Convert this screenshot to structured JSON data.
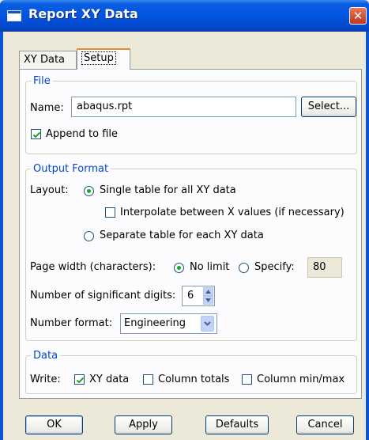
{
  "window": {
    "title": "Report XY Data",
    "close_glyph": "✕"
  },
  "tabs": [
    {
      "label": "XY Data",
      "selected": false
    },
    {
      "label": "Setup",
      "selected": true
    }
  ],
  "file": {
    "legend": "File",
    "name_label": "Name:",
    "name_value": "abaqus.rpt",
    "select_button": "Select...",
    "append_label": "Append to file",
    "append_checked": true
  },
  "output": {
    "legend": "Output Format",
    "layout_label": "Layout:",
    "single_label": "Single table for all XY data",
    "single_selected": true,
    "interpolate_label": "Interpolate between X values (if necessary)",
    "interpolate_checked": false,
    "separate_label": "Separate table for each XY data",
    "separate_selected": false,
    "page_width_label": "Page width (characters):",
    "no_limit_label": "No limit",
    "no_limit_selected": true,
    "specify_label": "Specify:",
    "specify_value": "80",
    "digits_label": "Number of significant digits:",
    "digits_value": "6",
    "number_format_label": "Number format:",
    "number_format_value": "Engineering"
  },
  "data": {
    "legend": "Data",
    "write_label": "Write:",
    "xy_data_label": "XY data",
    "xy_data_checked": true,
    "column_totals_label": "Column totals",
    "column_totals_checked": false,
    "column_minmax_label": "Column min/max",
    "column_minmax_checked": false
  },
  "buttons": {
    "ok": "OK",
    "apply": "Apply",
    "defaults": "Defaults",
    "cancel": "Cancel"
  },
  "colors": {
    "title_blue": "#0254e0",
    "legend_blue": "#0046d5",
    "radio_green": "#21a121",
    "check_green": "#21a121"
  }
}
